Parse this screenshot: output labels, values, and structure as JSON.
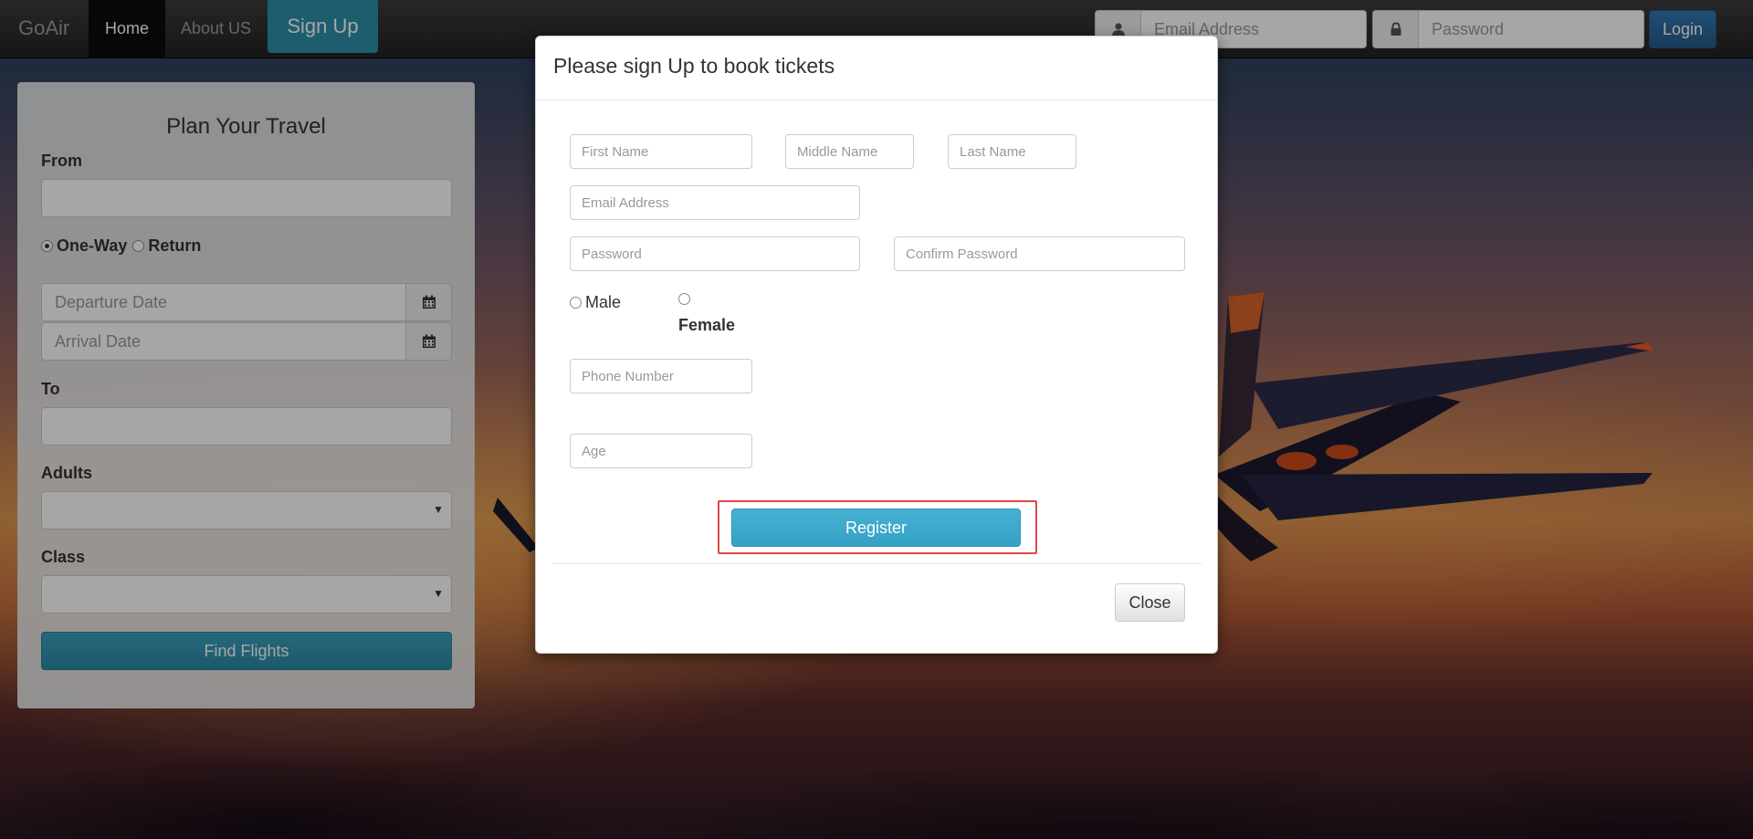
{
  "navbar": {
    "brand": "GoAir",
    "home": "Home",
    "about": "About US",
    "signup": "Sign Up",
    "email_placeholder": "Email Address",
    "password_placeholder": "Password",
    "login": "Login",
    "icons": {
      "email": "user-icon",
      "password": "lock-icon"
    }
  },
  "plan": {
    "title": "Plan Your Travel",
    "from_label": "From",
    "trip_type": {
      "one_way": "One-Way",
      "return": "Return",
      "selected": "One-Way"
    },
    "departure_placeholder": "Departure Date",
    "arrival_placeholder": "Arrival Date",
    "to_label": "To",
    "adults_label": "Adults",
    "class_label": "Class",
    "find_button": "Find Flights"
  },
  "modal": {
    "title": "Please sign Up to book tickets",
    "fields": {
      "first_name": "First Name",
      "middle_name": "Middle Name",
      "last_name": "Last Name",
      "email": "Email Address",
      "password": "Password",
      "confirm_password": "Confirm Password",
      "phone": "Phone Number",
      "age": "Age"
    },
    "gender": {
      "male": "Male",
      "female": "Female"
    },
    "register": "Register",
    "close": "Close"
  },
  "colors": {
    "navbar": "#222222",
    "signup_accent": "#2f90a9",
    "login_button": "#337ab7",
    "register_button": "#3aa9cc",
    "highlight_frame": "#e04848"
  }
}
